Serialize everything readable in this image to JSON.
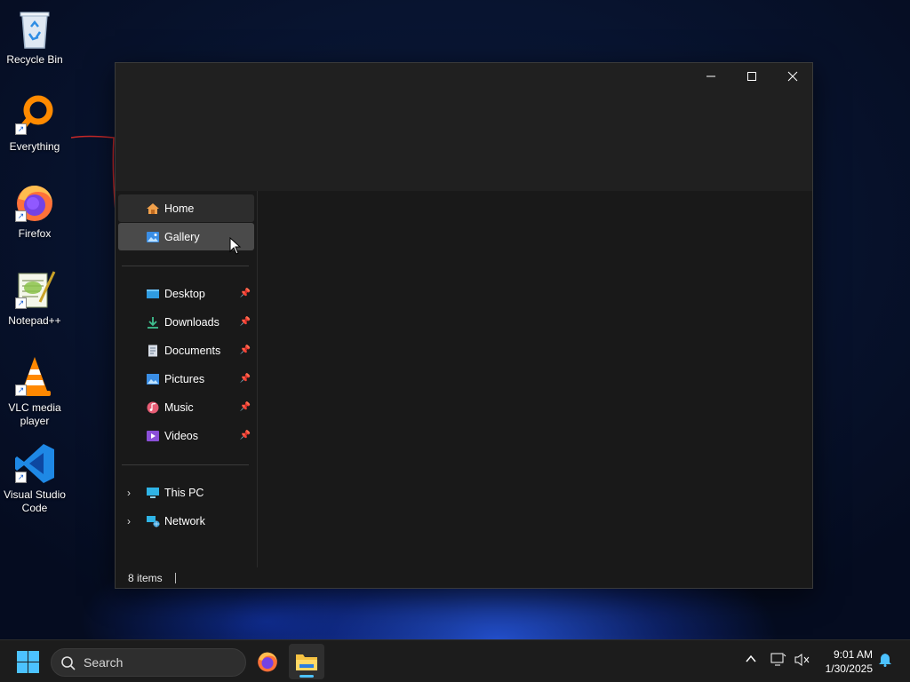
{
  "desktop": {
    "icons": [
      {
        "label": "Recycle Bin"
      },
      {
        "label": "Everything"
      },
      {
        "label": "Firefox"
      },
      {
        "label": "Notepad++"
      },
      {
        "label": "VLC media player"
      },
      {
        "label": "Visual Studio Code"
      }
    ]
  },
  "window": {
    "controls": {
      "minimize": "—",
      "maximize": "☐",
      "close": "✕"
    },
    "nav": {
      "quick": [
        {
          "label": "Home",
          "icon": "home-icon"
        },
        {
          "label": "Gallery",
          "icon": "gallery-icon"
        }
      ],
      "pinned": [
        {
          "label": "Desktop",
          "icon": "desktop-icon",
          "pinned": true
        },
        {
          "label": "Downloads",
          "icon": "downloads-icon",
          "pinned": true
        },
        {
          "label": "Documents",
          "icon": "documents-icon",
          "pinned": true
        },
        {
          "label": "Pictures",
          "icon": "pictures-icon",
          "pinned": true
        },
        {
          "label": "Music",
          "icon": "music-icon",
          "pinned": true
        },
        {
          "label": "Videos",
          "icon": "videos-icon",
          "pinned": true
        }
      ],
      "locations": [
        {
          "label": "This PC",
          "icon": "computer-icon"
        },
        {
          "label": "Network",
          "icon": "network-icon"
        }
      ]
    },
    "status": {
      "item_count": "8 items"
    }
  },
  "taskbar": {
    "search_placeholder": "Search",
    "clock": {
      "time": "9:01 AM",
      "date": "1/30/2025"
    }
  },
  "colors": {
    "accent": "#4cc2ff",
    "window_bg": "#191919",
    "titlebar_bg": "#202020",
    "hover_bg": "#4a4a4a"
  }
}
